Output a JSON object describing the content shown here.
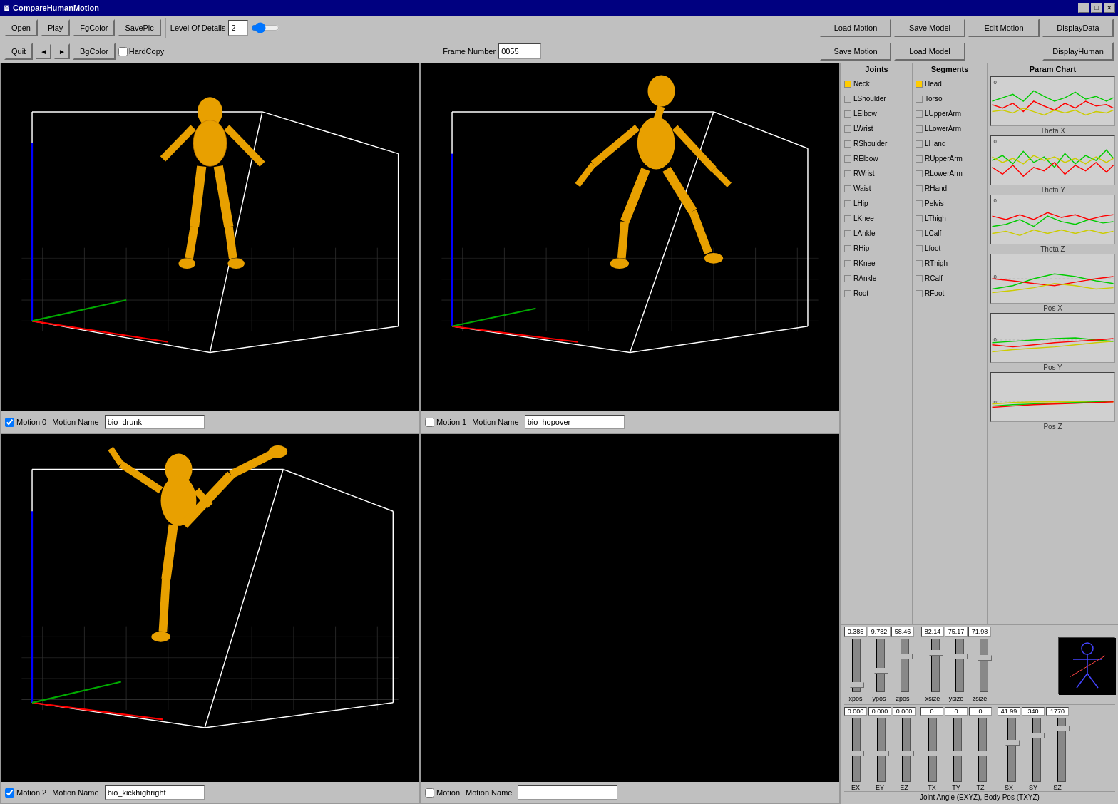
{
  "window": {
    "title": "CompareHumanMotion",
    "icon": "🖥"
  },
  "toolbar": {
    "row1": {
      "open_label": "Open",
      "play_label": "Play",
      "fgcolor_label": "FgColor",
      "savepic_label": "SavePic",
      "level_of_details_label": "Level Of Details",
      "level_value": "2",
      "frame_number_label": "Frame Number",
      "frame_value": "0055"
    },
    "row2": {
      "quit_label": "Quit",
      "prev_label": "◄",
      "next_label": "►",
      "bgcolor_label": "BgColor",
      "hardcopy_label": "HardCopy"
    },
    "right_buttons": {
      "load_motion": "Load Motion",
      "save_model": "Save Model",
      "edit_motion": "Edit Motion",
      "display_data": "DisplayData",
      "save_motion": "Save Motion",
      "load_model": "Load Model",
      "display_human": "DisplayHuman"
    }
  },
  "viewports": [
    {
      "id": "vp0",
      "motion_label": "Motion 0",
      "motion_name_label": "Motion Name",
      "motion_name_value": "bio_drunk",
      "checked": true
    },
    {
      "id": "vp1",
      "motion_label": "Motion 1",
      "motion_name_label": "Motion Name",
      "motion_name_value": "bio_hopover",
      "checked": false
    },
    {
      "id": "vp2",
      "motion_label": "Motion 2",
      "motion_name_label": "Motion Name",
      "motion_name_value": "bio_kickhighright",
      "checked": true
    },
    {
      "id": "vp3",
      "motion_label": "Motion",
      "motion_name_label": "Motion Name",
      "motion_name_value": "",
      "checked": false
    }
  ],
  "right_panel": {
    "joints_header": "Joints",
    "segments_header": "Segments",
    "param_chart_header": "Param Chart",
    "joints": [
      "Neck",
      "LShoulder",
      "LElbow",
      "LWrist",
      "RShoulder",
      "RElbow",
      "RWrist",
      "Waist",
      "LHip",
      "LKnee",
      "LAnkle",
      "RHip",
      "RKnee",
      "RAnkle",
      "Root"
    ],
    "segments": [
      "Head",
      "Torso",
      "LUpperArm",
      "LLowerArm",
      "LHand",
      "RUpperArm",
      "RLowerArm",
      "RHand",
      "Pelvis",
      "LThigh",
      "LCalf",
      "Lfoot",
      "RThigh",
      "RCalf",
      "RFoot"
    ],
    "chart_labels": [
      "Theta X",
      "Theta Y",
      "Theta Z",
      "Pos X",
      "Pos Y",
      "Pos Z"
    ],
    "sliders": {
      "xpos_val": "0.385",
      "ypos_val": "9.782",
      "zpos_val": "58.46",
      "xsize_val": "82.14",
      "ysize_val": "75.17",
      "zsize_val": "71.98",
      "xpos_label": "xpos",
      "ypos_label": "ypos",
      "zpos_label": "zpos",
      "xsize_label": "xsize",
      "ysize_label": "ysize",
      "zsize_label": "zsize"
    },
    "euler": {
      "ex_val": "0.000",
      "ey_val": "0.000",
      "ez_val": "0.000",
      "ex_label": "EX",
      "ey_label": "EY",
      "ez_label": "EZ",
      "tx_val": "0",
      "ty_val": "0",
      "tz_val": "0",
      "sx_val": "41.99",
      "sy_val": "340",
      "sz_val": "1770",
      "tx_label": "TX",
      "ty_label": "TY",
      "tz_label": "TZ",
      "sx_label": "SX",
      "sy_label": "SY",
      "sz_label": "SZ"
    },
    "status_label": "Joint Angle (EXYZ), Body Pos (TXYZ)"
  }
}
